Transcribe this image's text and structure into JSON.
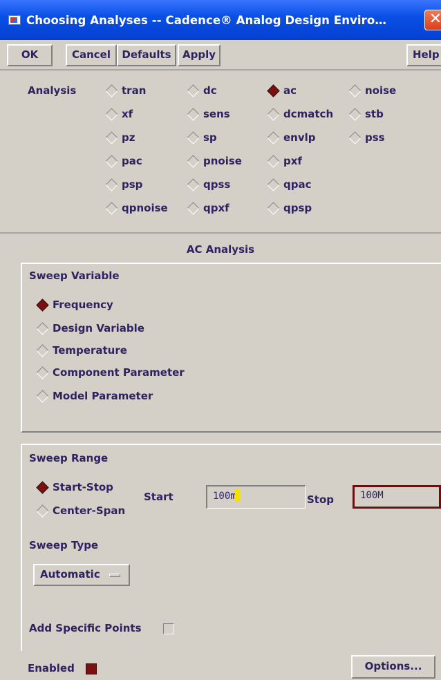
{
  "window": {
    "title": "Choosing Analyses -- Cadence® Analog Design Enviro…",
    "close": "✕"
  },
  "toolbar": {
    "ok": "OK",
    "cancel": "Cancel",
    "defaults": "Defaults",
    "apply": "Apply",
    "help": "Help"
  },
  "analysis": {
    "label": "Analysis",
    "options": [
      "tran",
      "dc",
      "ac",
      "noise",
      "xf",
      "sens",
      "dcmatch",
      "stb",
      "pz",
      "sp",
      "envlp",
      "pss",
      "pac",
      "pnoise",
      "pxf",
      "psp",
      "qpss",
      "qpac",
      "qpnoise",
      "qpxf",
      "qpsp"
    ],
    "selected": "ac"
  },
  "ac_title": "AC Analysis",
  "sweep_variable": {
    "title": "Sweep Variable",
    "options": [
      "Frequency",
      "Design Variable",
      "Temperature",
      "Component Parameter",
      "Model Parameter"
    ],
    "selected": "Frequency"
  },
  "sweep_range": {
    "title": "Sweep Range",
    "options": [
      "Start-Stop",
      "Center-Span"
    ],
    "selected": "Start-Stop",
    "start_label": "Start",
    "start_value": "100m",
    "stop_label": "Stop",
    "stop_value": "100M"
  },
  "sweep_type": {
    "title": "Sweep Type",
    "value": "Automatic"
  },
  "add_specific_points": {
    "label": "Add Specific Points",
    "checked": false
  },
  "enabled": {
    "label": "Enabled",
    "checked": true
  },
  "options_button": "Options...",
  "colors": {
    "accent": "#7a1010",
    "text": "#2e2360",
    "background": "#d4d0c8",
    "titlebar": "#0a50e6"
  }
}
